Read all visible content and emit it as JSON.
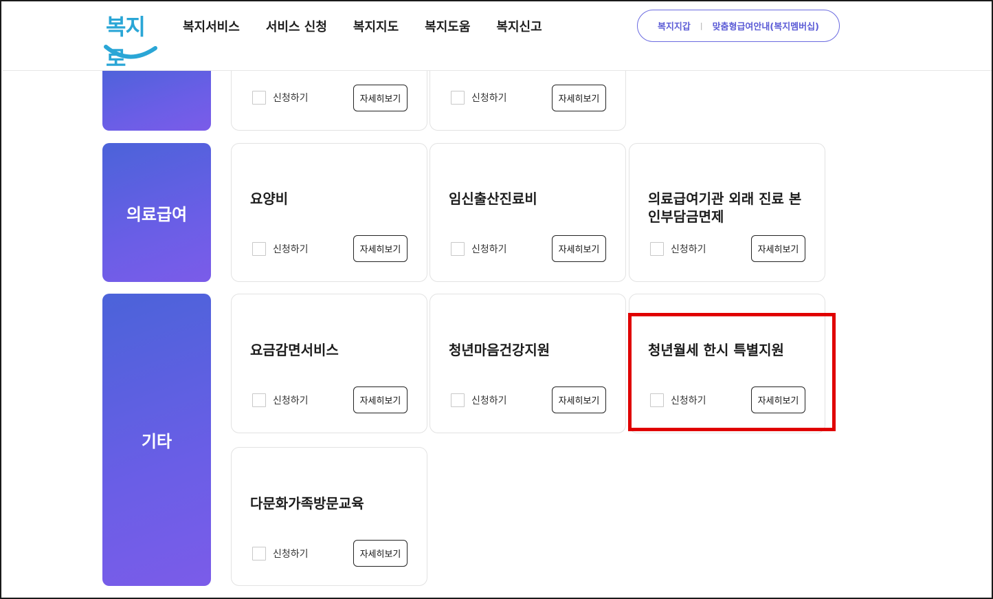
{
  "header": {
    "logo_text": "복지로",
    "nav": [
      "복지서비스",
      "서비스 신청",
      "복지지도",
      "복지도움",
      "복지신고"
    ],
    "pill_links": [
      "복지지갑",
      "맞춤형급여안내(복지멤버십)"
    ]
  },
  "common": {
    "apply_label": "신청하기",
    "detail_label": "자세히보기"
  },
  "categories": [
    {
      "label": "의료급여"
    },
    {
      "label": "기타"
    }
  ],
  "cards": [
    {
      "title": ""
    },
    {
      "title": ""
    },
    {
      "title": "요양비"
    },
    {
      "title": "임신출산진료비"
    },
    {
      "title": "의료급여기관 외래 진료 본인부담금면제"
    },
    {
      "title": "요금감면서비스"
    },
    {
      "title": "청년마음건강지원"
    },
    {
      "title": "청년월세 한시 특별지원"
    },
    {
      "title": "다문화가족방문교육"
    }
  ],
  "colors": {
    "accent": "#5b5bd6",
    "category_gradient_start": "#4b63d9",
    "category_gradient_end": "#7b5ce9",
    "highlight": "#e00000"
  }
}
